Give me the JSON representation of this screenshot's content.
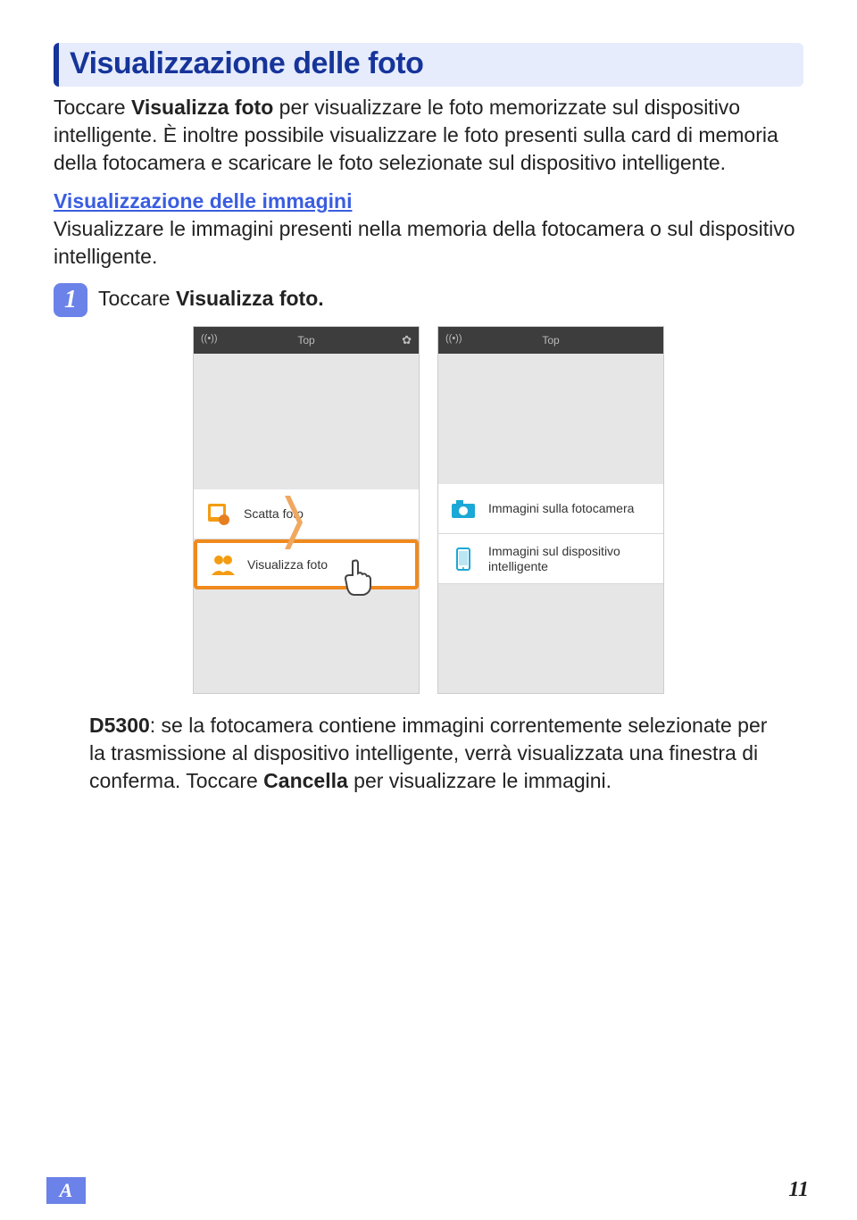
{
  "section_title": "Visualizzazione delle foto",
  "intro_before": "Toccare ",
  "intro_bold": "Visualizza foto",
  "intro_after": " per visualizzare le foto memorizzate sul dispositivo intelligente. È inoltre possibile visualizzare le foto presenti sulla card di memoria della fotocamera e scaricare le foto selezionate sul dispositivo intelligente.",
  "sub_heading": "Visualizzazione delle immagini",
  "sub_body": "Visualizzare le immagini presenti nella memoria della fotocamera o sul dispositivo intelligente.",
  "step_number": "1",
  "step_before": "Toccare ",
  "step_bold": "Visualizza foto.",
  "phone_left": {
    "top_label": "Top",
    "item1": "Scatta foto",
    "item2": "Visualizza foto"
  },
  "phone_right": {
    "top_label": "Top",
    "item1": "Immagini sulla fotocamera",
    "item2": "Immagini sul dispositivo intelligente"
  },
  "note_bold1": "D5300",
  "note_mid": ": se la fotocamera contiene immagini correntemente selezionate per la trasmissione al dispositivo intelligente, verrà visualizzata una finestra di conferma. Toccare ",
  "note_bold2": "Cancella",
  "note_end": " per visualizzare le immagini.",
  "footer_letter": "A",
  "page_number": "11"
}
